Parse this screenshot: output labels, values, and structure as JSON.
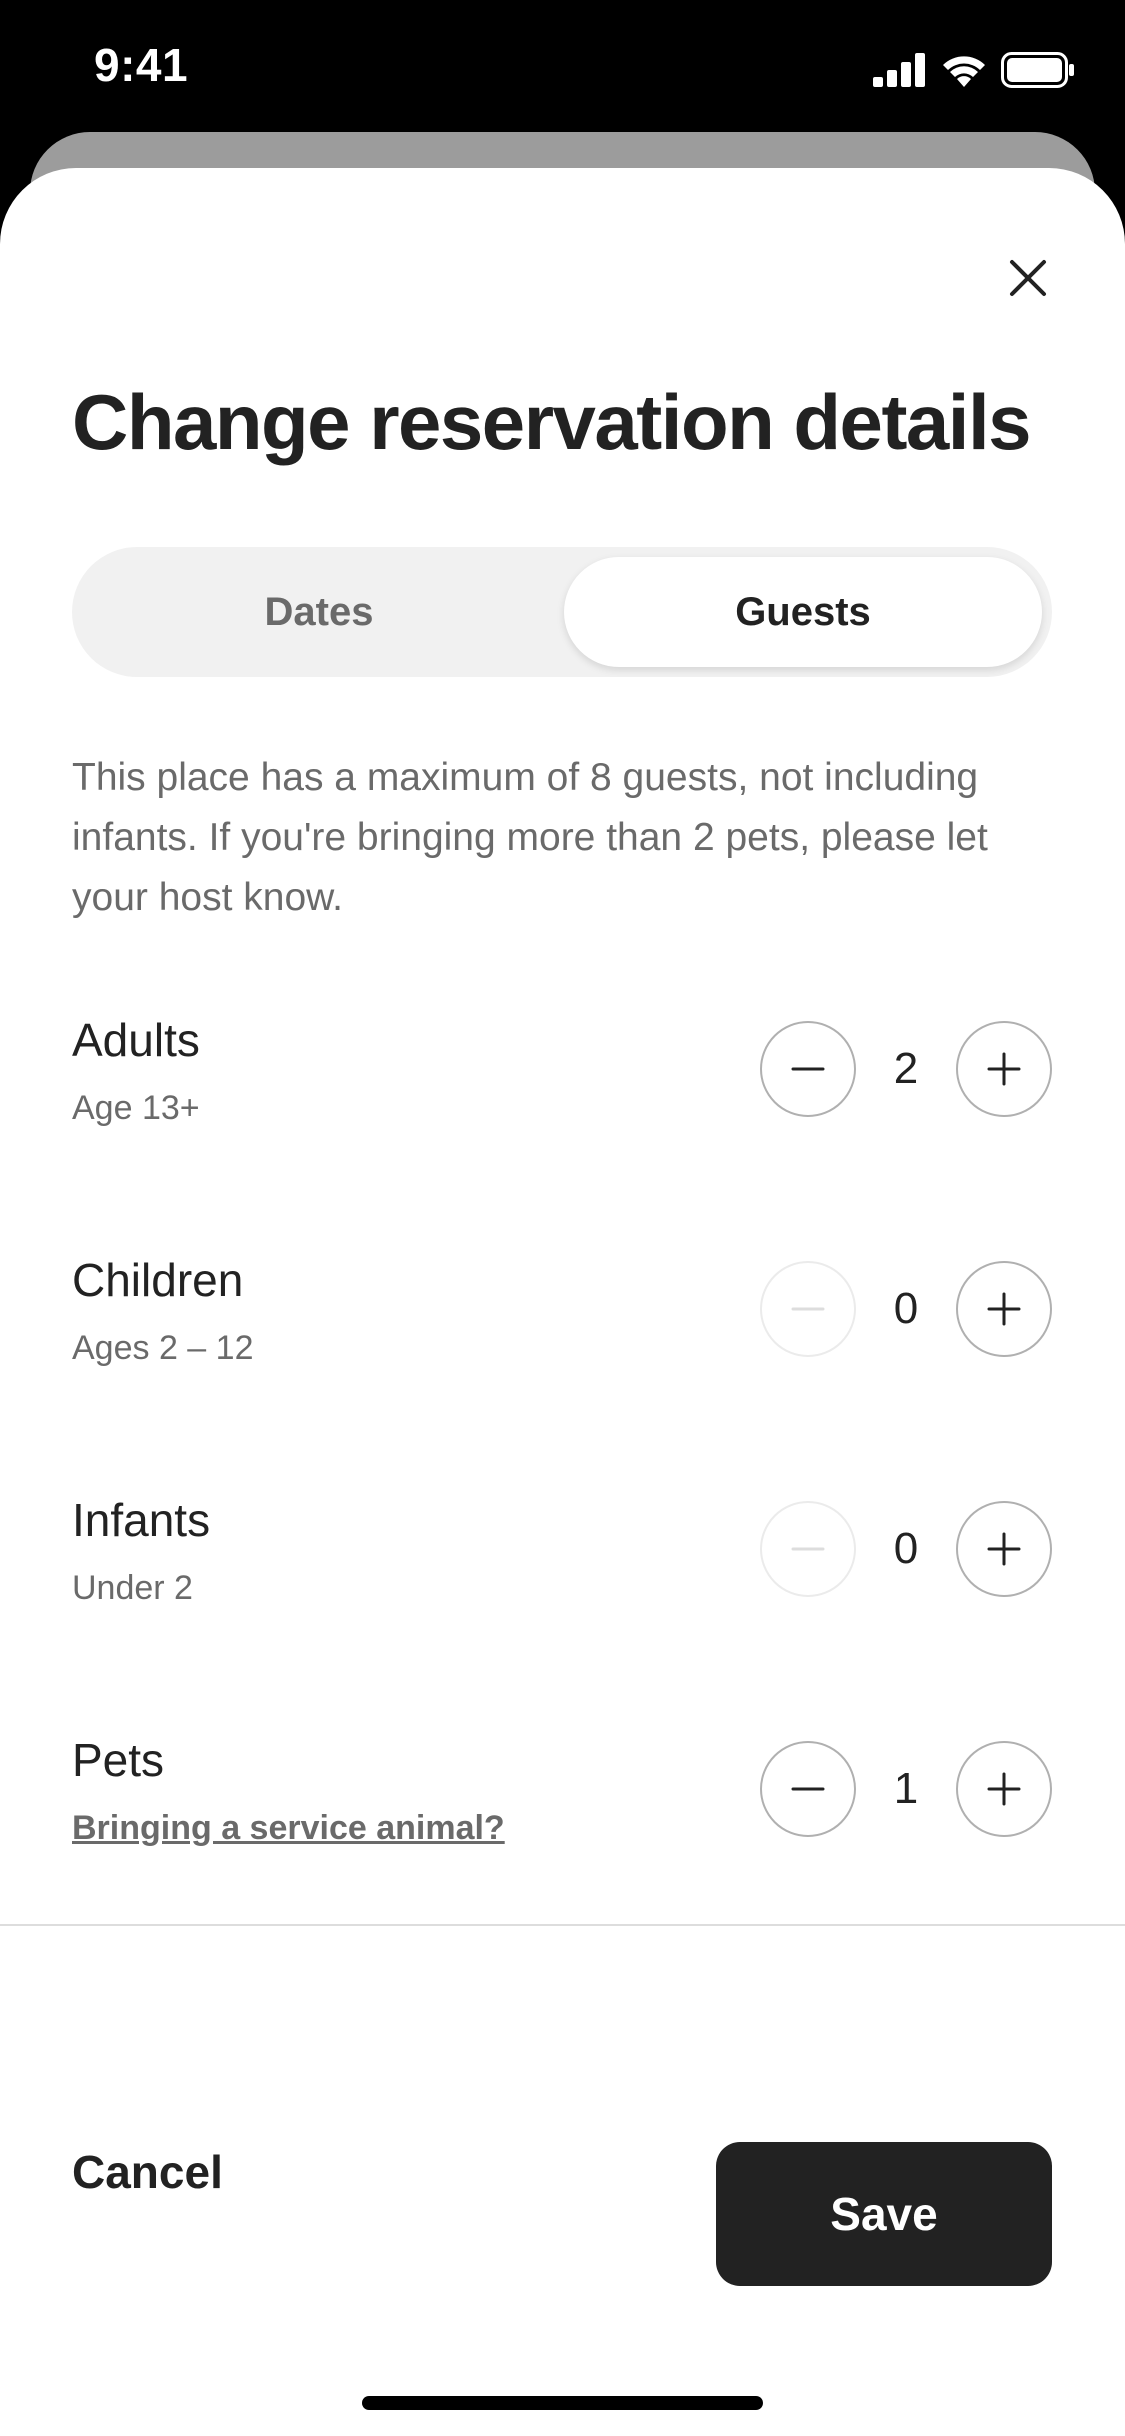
{
  "status_bar": {
    "time": "9:41",
    "icons": [
      "signal-icon",
      "wifi-icon",
      "battery-icon"
    ]
  },
  "modal": {
    "title": "Change reservation details",
    "close_icon": "close-icon",
    "tabs": [
      {
        "label": "Dates",
        "selected": false
      },
      {
        "label": "Guests",
        "selected": true
      }
    ],
    "info_text": "This place has a maximum of 8 guests, not including infants. If you're bringing more than 2 pets, please let your host know.",
    "guest_types": [
      {
        "label": "Adults",
        "sublabel": "Age 13+",
        "count": "2",
        "minus_enabled": true
      },
      {
        "label": "Children",
        "sublabel": "Ages 2 – 12",
        "count": "0",
        "minus_enabled": false
      },
      {
        "label": "Infants",
        "sublabel": "Under 2",
        "count": "0",
        "minus_enabled": false
      },
      {
        "label": "Pets",
        "link": "Bringing a service animal?",
        "count": "1",
        "minus_enabled": true
      }
    ]
  },
  "footer": {
    "cancel_label": "Cancel",
    "save_label": "Save"
  },
  "colors": {
    "text_primary": "#222222",
    "text_secondary": "#6a6a6a",
    "stepper_border": "#b0b0b0",
    "stepper_border_disabled": "#ebebeb",
    "save_button_bg": "#222222"
  }
}
